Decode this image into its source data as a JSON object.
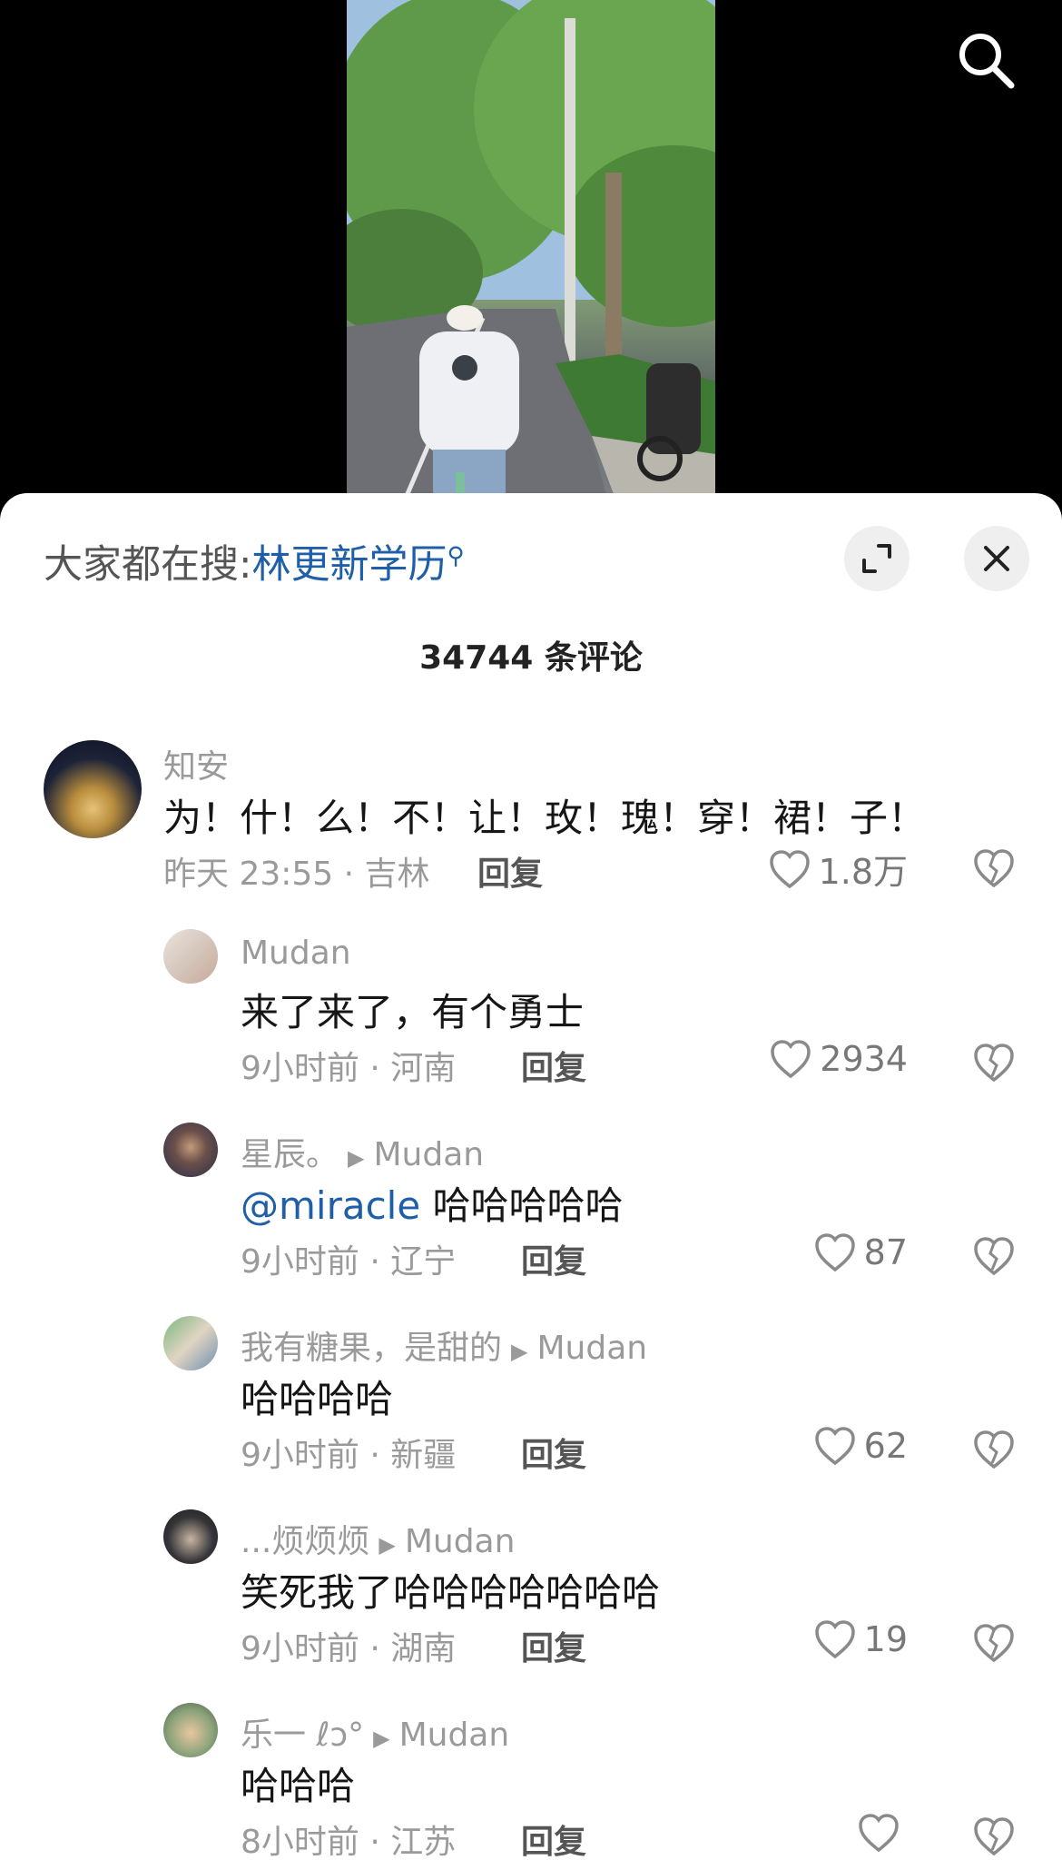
{
  "header": {
    "search_label": "大家都在搜:",
    "search_keyword": "林更新学历"
  },
  "comment_count": "34744 条评论",
  "comments": [
    {
      "username": "知安",
      "text": "为！什！么！不！让！玫！瑰！穿！裙！子！",
      "time_location": "昨天 23:55 · 吉林",
      "reply_label": "回复",
      "likes": "1.8万"
    }
  ],
  "replies": [
    {
      "username": "Mudan",
      "reply_to": "",
      "mention": "",
      "text": "来了来了，有个勇士",
      "time_location": "9小时前 · 河南",
      "reply_label": "回复",
      "likes": "2934"
    },
    {
      "username": "星辰。",
      "reply_to": "Mudan",
      "mention": "@miracle",
      "text": "哈哈哈哈哈",
      "time_location": "9小时前 · 辽宁",
      "reply_label": "回复",
      "likes": "87"
    },
    {
      "username": "我有糖果，是甜的",
      "reply_to": "Mudan",
      "mention": "",
      "text": "哈哈哈哈",
      "time_location": "9小时前 · 新疆",
      "reply_label": "回复",
      "likes": "62"
    },
    {
      "username": "...烦烦烦",
      "reply_to": "Mudan",
      "mention": "",
      "text": "笑死我了哈哈哈哈哈哈哈",
      "time_location": "9小时前 · 湖南",
      "reply_label": "回复",
      "likes": "19"
    },
    {
      "username": "乐一 ℓɔ°",
      "reply_to": "Mudan",
      "mention": "",
      "text": "哈哈哈",
      "time_location": "8小时前 · 江苏",
      "reply_label": "回复",
      "likes": ""
    }
  ],
  "icons": {
    "search": "search-icon",
    "expand": "expand-icon",
    "close": "close-icon",
    "like": "heart-icon",
    "dislike": "broken-heart-icon",
    "reply_arrow": "play-arrow-icon"
  },
  "colors": {
    "accent": "#1f5ea8",
    "muted": "#9a9a9a"
  }
}
